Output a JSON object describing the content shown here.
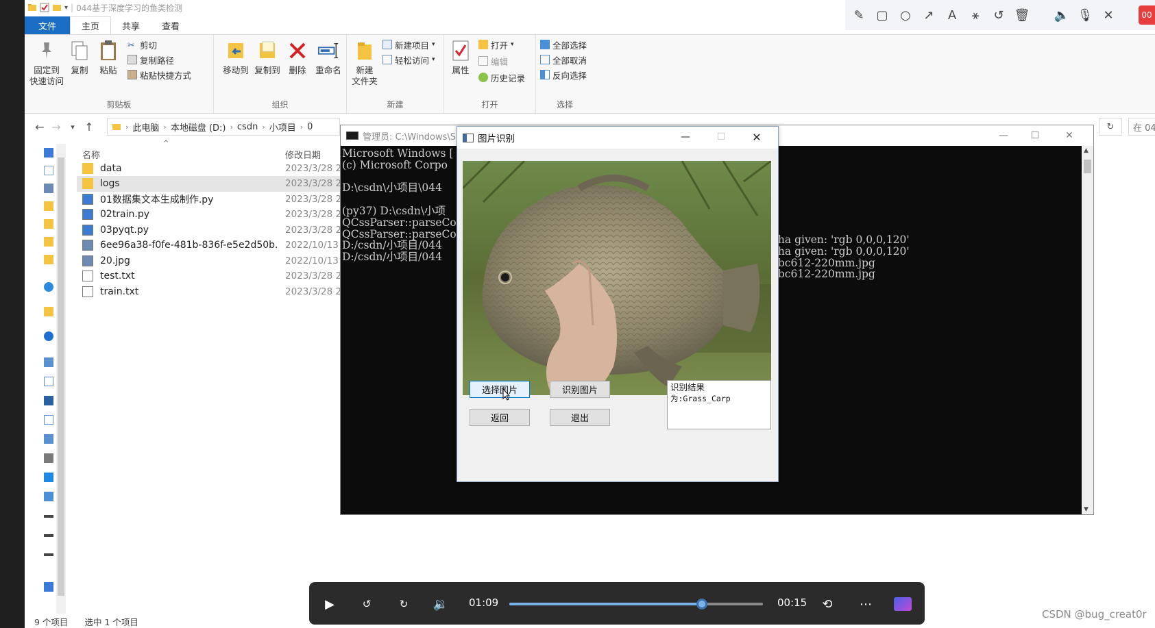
{
  "explorer": {
    "title": "044基于深度学习的鱼类检测",
    "tabs": [
      "文件",
      "主页",
      "共享",
      "查看"
    ],
    "ribbon": {
      "clipboard": {
        "pin_label": "固定到\n快速访问",
        "copy_label": "复制",
        "paste_label": "粘贴",
        "cut_label": "剪切",
        "copy_path_label": "复制路径",
        "paste_shortcut_label": "粘贴快捷方式",
        "group_label": "剪贴板"
      },
      "organize": {
        "move_to_label": "移动到",
        "copy_to_label": "复制到",
        "delete_label": "删除",
        "rename_label": "重命名",
        "group_label": "组织"
      },
      "new": {
        "new_folder_label": "新建\n文件夹",
        "new_item_label": "新建项目",
        "easy_access_label": "轻松访问",
        "group_label": "新建"
      },
      "open": {
        "properties_label": "属性",
        "open_label": "打开",
        "edit_label": "编辑",
        "history_label": "历史记录",
        "group_label": "打开"
      },
      "select": {
        "select_all_label": "全部选择",
        "select_none_label": "全部取消",
        "invert_label": "反向选择",
        "group_label": "选择"
      }
    },
    "breadcrumb": [
      "此电脑",
      "本地磁盘 (D:)",
      "csdn",
      "小项目",
      "0"
    ],
    "search_placeholder": "在 04",
    "columns": {
      "name": "名称",
      "modified": "修改日期"
    },
    "files": [
      {
        "name": "data",
        "date": "2023/3/28 2",
        "type": "folder"
      },
      {
        "name": "logs",
        "date": "2023/3/28 2",
        "type": "folder"
      },
      {
        "name": "01数据集文本生成制作.py",
        "date": "2023/3/28 2",
        "type": "py"
      },
      {
        "name": "02train.py",
        "date": "2023/3/28 2",
        "type": "py"
      },
      {
        "name": "03pyqt.py",
        "date": "2023/3/28 2",
        "type": "py"
      },
      {
        "name": "6ee96a38-f0fe-481b-836f-e5e2d50b...",
        "date": "2022/10/13",
        "type": "img"
      },
      {
        "name": "20.jpg",
        "date": "2022/10/13",
        "type": "img"
      },
      {
        "name": "test.txt",
        "date": "2023/3/28 2",
        "type": "txt"
      },
      {
        "name": "train.txt",
        "date": "2023/3/28 2",
        "type": "txt"
      }
    ],
    "status": {
      "count": "9 个项目",
      "selected": "选中 1 个项目"
    }
  },
  "console": {
    "title": "管理员: C:\\Windows\\S",
    "lines": [
      "Microsoft Windows [",
      "(c) Microsoft Corpo",
      "",
      "D:\\csdn\\小项目\\044",
      "",
      "(py37) D:\\csdn\\小项",
      "QCssParser::parseCo",
      "QCssParser::parseCo",
      "D:/csdn/小项目/044",
      "D:/csdn/小项目/044"
    ],
    "right_lines": [
      "pha given: 'rgb 0,0,0,120'",
      "pha given: 'rgb 0,0,0,120'",
      "0bc612-220mm.jpg",
      "0bc612-220mm.jpg"
    ]
  },
  "dialog": {
    "title": "图片识别",
    "select_image_label": "选择图片",
    "recognize_label": "识别图片",
    "back_label": "返回",
    "exit_label": "退出",
    "result_title": "识别结果",
    "result_value": "为:Grass_Carp"
  },
  "player": {
    "current_time": "01:09",
    "remaining_time": "00:15",
    "progress": 0.76
  },
  "watermark": "CSDN @bug_creat0r",
  "rec_badge": "00",
  "colors": {
    "file_tab": "#1a6fc5",
    "player_bg": "#2b2b2b",
    "seek": "#7ab3ea"
  }
}
